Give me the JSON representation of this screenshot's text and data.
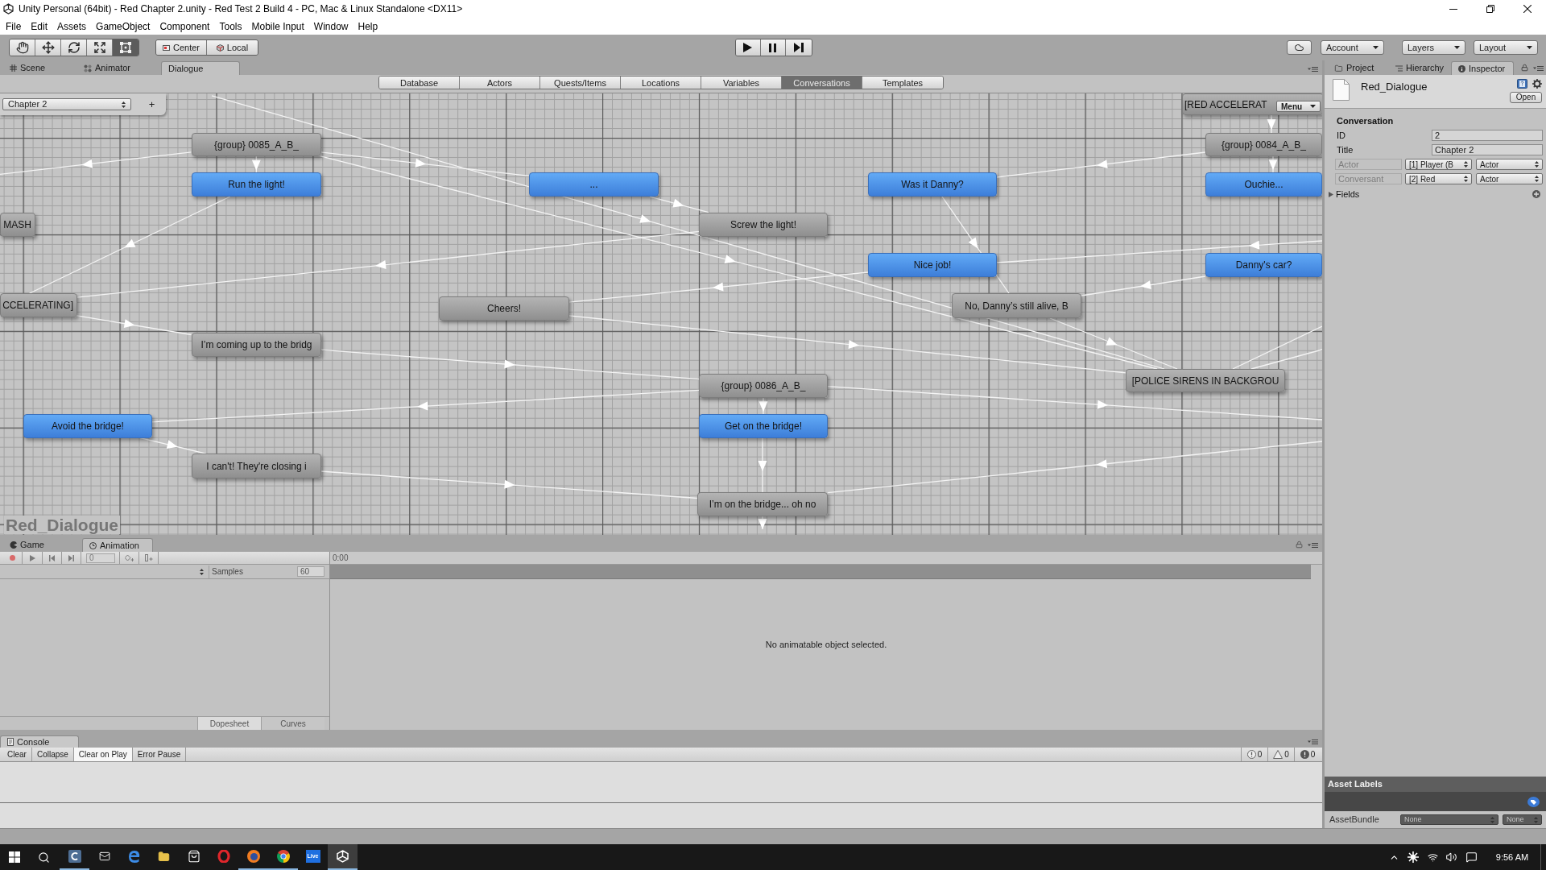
{
  "window": {
    "title": "Unity Personal (64bit) - Red Chapter 2.unity - Red Test 2 Build 4 - PC, Mac & Linux Standalone <DX11>"
  },
  "menu": [
    "File",
    "Edit",
    "Assets",
    "GameObject",
    "Component",
    "Tools",
    "Mobile Input",
    "Window",
    "Help"
  ],
  "toolbar": {
    "tools": [
      {
        "selected": false
      },
      {
        "selected": false
      },
      {
        "selected": false
      },
      {
        "selected": false
      },
      {
        "selected": true
      }
    ],
    "pivot": [
      "Center",
      "Local"
    ],
    "account": "Account",
    "layers": "Layers",
    "layout": "Layout"
  },
  "scene_tabs": [
    {
      "label": "Scene",
      "selected": false
    },
    {
      "label": "Animator",
      "selected": false
    },
    {
      "label": "Dialogue",
      "selected": true
    }
  ],
  "dialogue_editor": {
    "tabs": [
      {
        "label": "Database",
        "selected": false
      },
      {
        "label": "Actors",
        "selected": false
      },
      {
        "label": "Quests/Items",
        "selected": false
      },
      {
        "label": "Locations",
        "selected": false
      },
      {
        "label": "Variables",
        "selected": false
      },
      {
        "label": "Conversations",
        "selected": true
      },
      {
        "label": "Templates",
        "selected": false
      }
    ],
    "conversation": "Chapter 2",
    "add_button": "+",
    "menu_button": "Menu",
    "asset_name": "Red_Dialogue",
    "nodes": [
      {
        "text": "[RED ACCELERAT",
        "kind": "line"
      },
      {
        "text": "{group} 0085_A_B_",
        "kind": "line"
      },
      {
        "text": "{group} 0084_A_B_",
        "kind": "line"
      },
      {
        "text": "Run the light!",
        "kind": "response"
      },
      {
        "text": "...",
        "kind": "response"
      },
      {
        "text": "Was it Danny?",
        "kind": "response"
      },
      {
        "text": "Ouchie...",
        "kind": "response"
      },
      {
        "text": "MASH",
        "kind": "line"
      },
      {
        "text": "Screw the light!",
        "kind": "line"
      },
      {
        "text": "Nice job!",
        "kind": "response"
      },
      {
        "text": "Danny's car?",
        "kind": "response"
      },
      {
        "text": "CCELERATING]",
        "kind": "line"
      },
      {
        "text": "Cheers!",
        "kind": "line"
      },
      {
        "text": "No, Danny’s still alive, B",
        "kind": "line"
      },
      {
        "text": "I’m coming up to the bridg",
        "kind": "line"
      },
      {
        "text": "[POLICE SIRENS IN BACKGROU",
        "kind": "line"
      },
      {
        "text": "{group} 0086_A_B_",
        "kind": "line"
      },
      {
        "text": "Avoid the bridge!",
        "kind": "response"
      },
      {
        "text": "Get on the bridge!",
        "kind": "response"
      },
      {
        "text": "I can't! They're closing i",
        "kind": "line"
      },
      {
        "text": "I’m on the bridge... oh no",
        "kind": "line"
      }
    ]
  },
  "bottom_tabs": [
    {
      "label": "Game",
      "selected": false
    },
    {
      "label": "Animation",
      "selected": true
    }
  ],
  "animation": {
    "frame": "0",
    "time": "0:00",
    "samples_label": "Samples",
    "samples": "60",
    "message": "No animatable object selected.",
    "views": [
      {
        "label": "Dopesheet",
        "selected": true
      },
      {
        "label": "Curves",
        "selected": false
      }
    ]
  },
  "console": {
    "tab": "Console",
    "buttons": [
      {
        "label": "Clear",
        "on": false
      },
      {
        "label": "Collapse",
        "on": false
      },
      {
        "label": "Clear on Play",
        "on": true
      },
      {
        "label": "Error Pause",
        "on": false
      }
    ],
    "counts": [
      "0",
      "0",
      "0"
    ]
  },
  "inspector": {
    "tabs": [
      {
        "label": "Project",
        "selected": false
      },
      {
        "label": "Hierarchy",
        "selected": false
      },
      {
        "label": "Inspector",
        "selected": true
      }
    ],
    "asset_name": "Red_Dialogue",
    "open_button": "Open",
    "section": "Conversation",
    "fields": [
      {
        "label": "ID",
        "value": "2"
      },
      {
        "label": "Title",
        "value": "Chapter 2"
      }
    ],
    "participants": [
      {
        "label": "Actor",
        "value": "[1] Player (B",
        "type": "Actor"
      },
      {
        "label": "Conversant",
        "value": "[2] Red",
        "type": "Actor"
      }
    ],
    "foldout": {
      "label": "Fields",
      "expanded": false
    },
    "asset_labels": "Asset Labels",
    "asset_bundle": {
      "label": "AssetBundle",
      "values": [
        "None",
        "None"
      ]
    }
  },
  "taskbar": {
    "apps": [
      {
        "running": true,
        "selected": false
      },
      {
        "running": false,
        "selected": false
      },
      {
        "running": false,
        "selected": false
      },
      {
        "running": false,
        "selected": false
      },
      {
        "running": false,
        "selected": false
      },
      {
        "running": false,
        "selected": false
      },
      {
        "running": true,
        "selected": false
      },
      {
        "running": true,
        "selected": false
      },
      {
        "label": "Live",
        "running": false,
        "selected": false
      },
      {
        "running": true,
        "selected": true
      }
    ],
    "clock": "9:56 AM"
  }
}
